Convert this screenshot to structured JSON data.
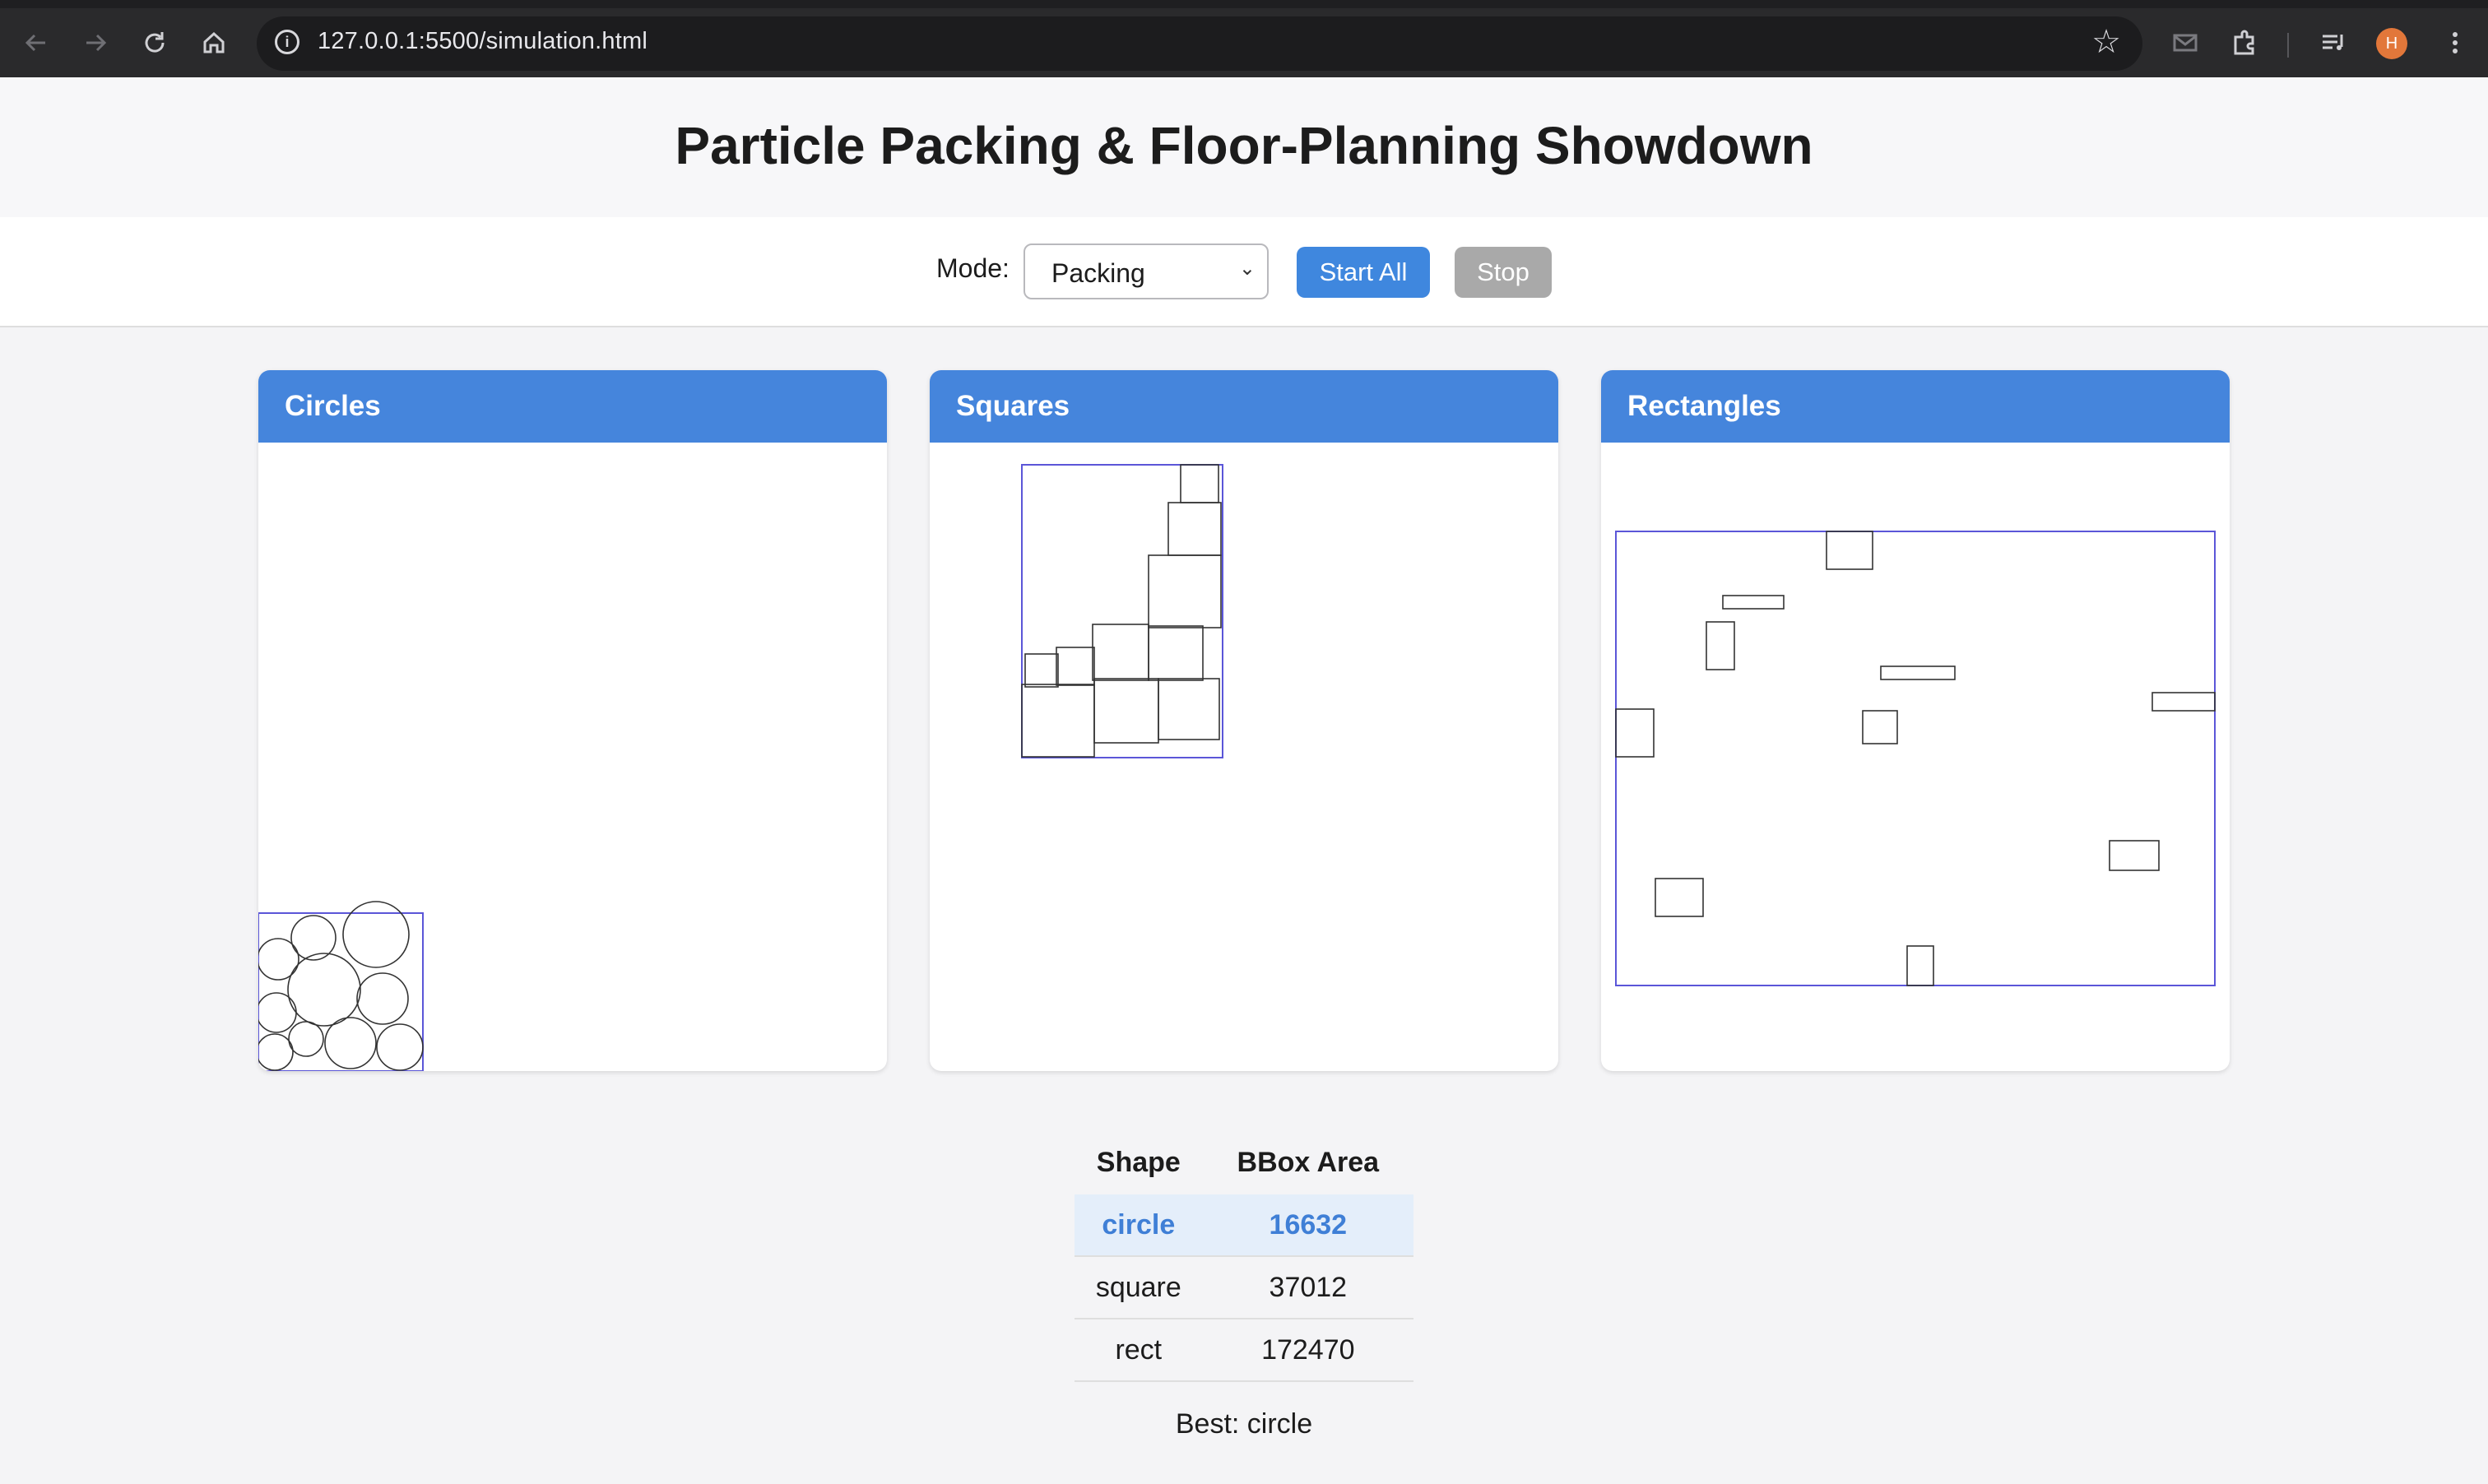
{
  "browser": {
    "url": "127.0.0.1:5500/simulation.html",
    "profile_initial": "H",
    "icons": [
      "back-icon",
      "forward-icon",
      "reload-icon",
      "home-icon",
      "info-icon",
      "bookmark-star-icon",
      "mail-icon",
      "extensions-icon",
      "media-icon",
      "menu-icon"
    ]
  },
  "page": {
    "title": "Particle Packing & Floor-Planning Showdown"
  },
  "controls": {
    "mode_label": "Mode:",
    "mode_value": "Packing",
    "start_label": "Start All",
    "stop_label": "Stop"
  },
  "panels": [
    {
      "title": "Circles"
    },
    {
      "title": "Squares"
    },
    {
      "title": "Rectangles"
    }
  ],
  "results": {
    "headers": [
      "Shape",
      "BBox Area"
    ],
    "rows": [
      {
        "shape": "circle",
        "area": "16632",
        "best": true
      },
      {
        "shape": "square",
        "area": "37012",
        "best": false
      },
      {
        "shape": "rect",
        "area": "172470",
        "best": false
      }
    ],
    "best_text": "Best: circle"
  },
  "colors": {
    "accent": "#4585dc",
    "stop_button": "#a9a9a9",
    "bbox_outline": "#5b56d8",
    "best_row_bg": "#e4eefa"
  }
}
